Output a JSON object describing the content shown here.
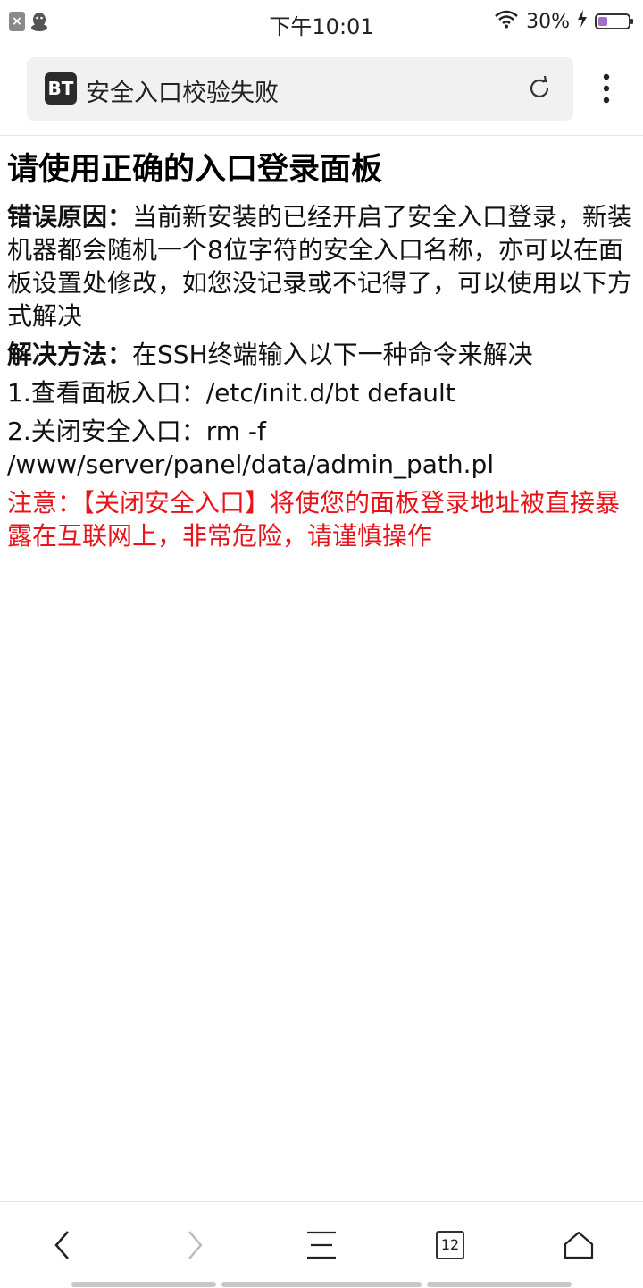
{
  "status_bar": {
    "time": "下午10:01",
    "battery_percent": "30%",
    "battery_level": 0.3,
    "notification_x": "×"
  },
  "browser": {
    "site_logo": "BT",
    "page_title": "安全入口校验失败",
    "tabs_count": "12"
  },
  "page": {
    "heading": "请使用正确的入口登录面板",
    "error_label": "错误原因：",
    "error_text": "当前新安装的已经开启了安全入口登录，新装机器都会随机一个8位字符的安全入口名称，亦可以在面板设置处修改，如您没记录或不记得了，可以使用以下方式解决",
    "solution_label": "解决方法：",
    "solution_text": "在SSH终端输入以下一种命令来解决",
    "step1": "1.查看面板入口：/etc/init.d/bt default",
    "step2": "2.关闭安全入口：rm -f /www/server/panel/data/admin_path.pl",
    "warning": "注意：【关闭安全入口】将使您的面板登录地址被直接暴露在互联网上，非常危险，请谨慎操作"
  },
  "colors": {
    "warning": "#e8141b",
    "url_bar_bg": "#f1f1f1",
    "battery_fill": "#a070c8"
  }
}
